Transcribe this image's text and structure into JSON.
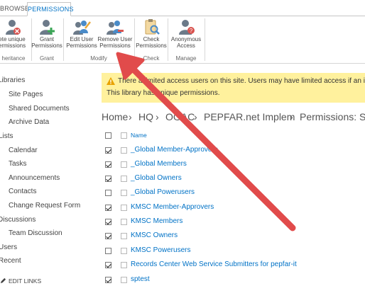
{
  "ribbon": {
    "tabs": [
      "BROWSE",
      "PERMISSIONS"
    ],
    "buttons": [
      {
        "line1": "ete unique",
        "line2": "ermissions"
      },
      {
        "line1": "Grant",
        "line2": "Permissions"
      },
      {
        "line1": "Edit User",
        "line2": "Permissions"
      },
      {
        "line1": "Remove User",
        "line2": "Permissions"
      },
      {
        "line1": "Check",
        "line2": "Permissions"
      },
      {
        "line1": "Anonymous",
        "line2": "Access"
      }
    ],
    "groups": [
      "heritance",
      "Grant",
      "Modify",
      "Check",
      "Manage"
    ]
  },
  "nav": {
    "items": [
      "Libraries",
      "Site Pages",
      "Shared Documents",
      "Archive Data",
      "Lists",
      "Calendar",
      "Tasks",
      "Announcements",
      "Contacts",
      "Change Request Form",
      "Discussions",
      "Team Discussion",
      "Users",
      "Recent"
    ],
    "edit_links": "EDIT LINKS"
  },
  "warning": {
    "line1": "There a   limited access users on this site. Users may have limited access if an item",
    "line2": "This library has unique permissions."
  },
  "breadcrumb": [
    "Home",
    "HQ",
    "OGAC",
    "PEPFAR.net Implem",
    "Permissions: Shar"
  ],
  "list": {
    "header": "Name",
    "rows": [
      {
        "name": "_Global Member-Approvers",
        "checked": true
      },
      {
        "name": "_Global Members",
        "checked": true
      },
      {
        "name": "_Global Owners",
        "checked": true
      },
      {
        "name": "_Global Powerusers",
        "checked": false
      },
      {
        "name": "KMSC Member-Approvers",
        "checked": true
      },
      {
        "name": "KMSC Members",
        "checked": true
      },
      {
        "name": "KMSC Owners",
        "checked": true
      },
      {
        "name": "KMSC Powerusers",
        "checked": false
      },
      {
        "name": "Records Center Web Service Submitters for pepfar-it",
        "checked": true
      },
      {
        "name": "sptest",
        "checked": true
      }
    ]
  },
  "colors": {
    "accent": "#0072c6",
    "warning_bg": "#fff19d",
    "arrow": "#e14b4b"
  }
}
